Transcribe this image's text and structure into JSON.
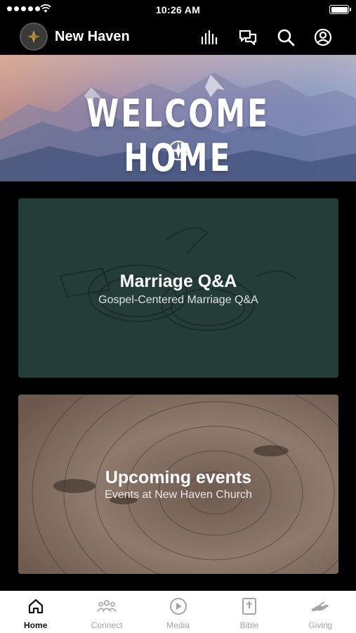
{
  "status_bar": {
    "time": "10:26 AM"
  },
  "header": {
    "title": "New Haven",
    "icons": [
      "equalizer-icon",
      "chat-icon",
      "search-icon",
      "profile-icon"
    ]
  },
  "banner": {
    "title": "WELCOME HOME"
  },
  "cards": [
    {
      "title": "Marriage Q&A",
      "subtitle": "Gospel-Centered Marriage Q&A"
    },
    {
      "title": "Upcoming events",
      "subtitle": "Events at New Haven Church"
    }
  ],
  "tabs": [
    {
      "label": "Home",
      "icon": "home-icon",
      "active": true
    },
    {
      "label": "Connect",
      "icon": "people-icon",
      "active": false
    },
    {
      "label": "Media",
      "icon": "play-icon",
      "active": false
    },
    {
      "label": "Bible",
      "icon": "bible-icon",
      "active": false
    },
    {
      "label": "Giving",
      "icon": "giving-icon",
      "active": false
    }
  ],
  "colors": {
    "background": "#000000",
    "marriage_card": "#243d38",
    "tab_active": "#111111",
    "tab_inactive": "#a6a6a6"
  }
}
